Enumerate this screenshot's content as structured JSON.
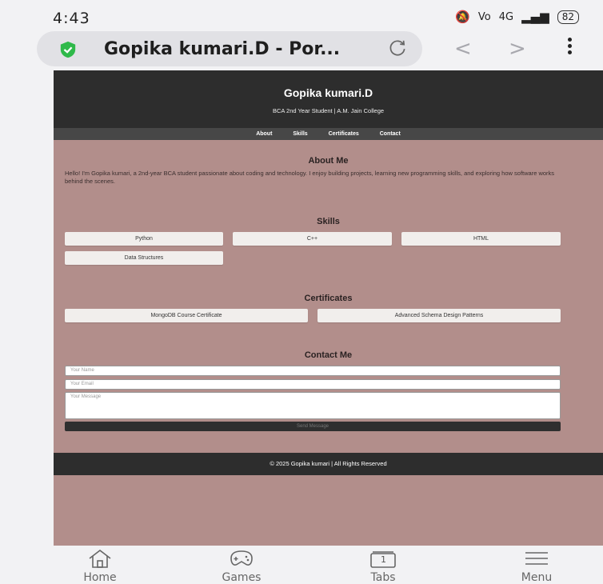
{
  "status": {
    "time": "4:43",
    "volte": "Vo",
    "network": "4G",
    "battery": "82"
  },
  "browser": {
    "tab_title": "Gopika kumari.D - Por...",
    "back_icon": "chevron-left-icon",
    "forward_icon": "chevron-right-icon",
    "reload_icon": "reload-icon",
    "shield_color": "#2fb94a"
  },
  "site": {
    "header_title": "Gopika kumari.D",
    "header_subtitle": "BCA 2nd Year Student | A.M. Jain College",
    "nav": [
      "About",
      "Skills",
      "Certificates",
      "Contact"
    ],
    "about": {
      "heading": "About Me",
      "text": "Hello! I'm Gopika kumari, a 2nd-year BCA student passionate about coding and technology. I enjoy building projects, learning new programming skills, and exploring how software works behind the scenes."
    },
    "skills": {
      "heading": "Skills",
      "items": [
        "Python",
        "C++",
        "HTML",
        "Data Structures"
      ]
    },
    "certificates": {
      "heading": "Certificates",
      "items": [
        "MongoDB Course Certificate",
        "Advanced Schema Design Patterns"
      ]
    },
    "contact": {
      "heading": "Contact Me",
      "name_placeholder": "Your Name",
      "email_placeholder": "Your Email",
      "message_placeholder": "Your Message",
      "send_label": "Send Message"
    },
    "footer": "© 2025 Gopika kumari | All Rights Reserved",
    "colors": {
      "page_bg": "#b28e8b",
      "header_bg": "#2d2d2d",
      "nav_bg": "#474747"
    }
  },
  "bottom_nav": {
    "home": "Home",
    "games": "Games",
    "tabs": "Tabs",
    "tabs_count": "1",
    "menu": "Menu"
  }
}
